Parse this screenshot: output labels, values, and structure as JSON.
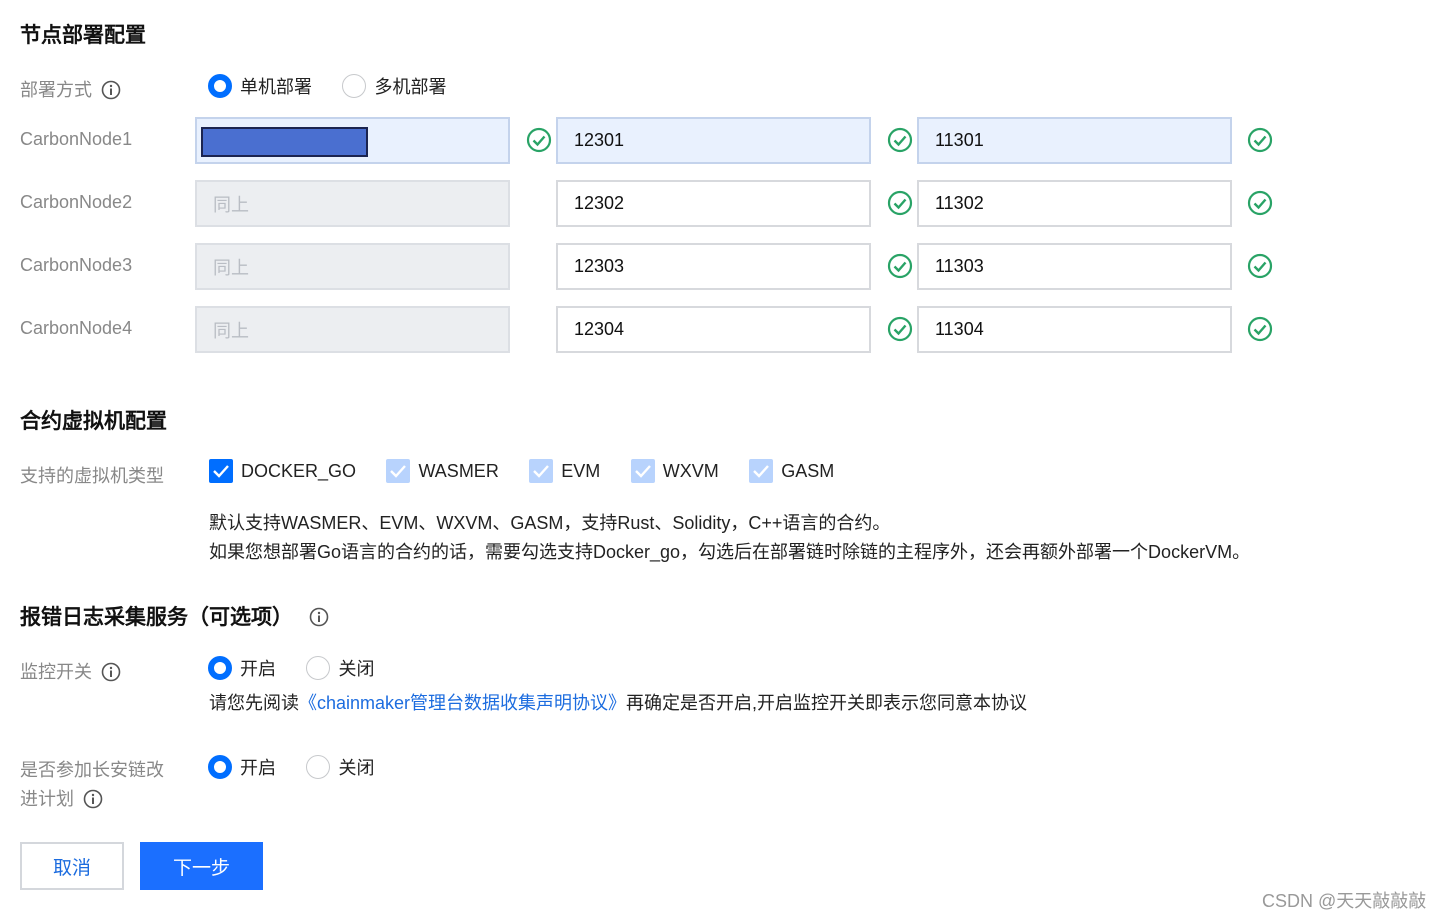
{
  "section_node": {
    "title": "节点部署配置",
    "deploy_mode_label": "部署方式",
    "options": [
      "单机部署",
      "多机部署"
    ],
    "selected": "单机部署"
  },
  "nodes": [
    {
      "name": "CarbonNode1",
      "ip": "",
      "port1": "12301",
      "port2": "11301"
    },
    {
      "name": "CarbonNode2",
      "ip": "同上",
      "port1": "12302",
      "port2": "11302"
    },
    {
      "name": "CarbonNode3",
      "ip": "同上",
      "port1": "12303",
      "port2": "11303"
    },
    {
      "name": "CarbonNode4",
      "ip": "同上",
      "port1": "12304",
      "port2": "11304"
    }
  ],
  "section_vm": {
    "title": "合约虚拟机配置",
    "vm_types_label": "支持的虚拟机类型",
    "vm_types": [
      {
        "label": "DOCKER_GO",
        "checked": true,
        "editable": true
      },
      {
        "label": "WASMER",
        "checked": true,
        "editable": false
      },
      {
        "label": "EVM",
        "checked": true,
        "editable": false
      },
      {
        "label": "WXVM",
        "checked": true,
        "editable": false
      },
      {
        "label": "GASM",
        "checked": true,
        "editable": false
      }
    ],
    "desc_line1": "默认支持WASMER、EVM、WXVM、GASM，支持Rust、Solidity，C++语言的合约。",
    "desc_line2": "如果您想部署Go语言的合约的话，需要勾选支持Docker_go，勾选后在部署链时除链的主程序外，还会再额外部署一个DockerVM。"
  },
  "section_log": {
    "title": "报错日志采集服务（可选项）",
    "monitor_label": "监控开关",
    "on_label": "开启",
    "off_label": "关闭",
    "monitor_selected": "开启",
    "notice_prefix": "请您先阅读",
    "notice_link": "《chainmaker管理台数据收集声明协议》",
    "notice_suffix": "再确定是否开启,开启监控开关即表示您同意本协议",
    "plan_label_line1": "是否参加长安链改",
    "plan_label_line2": "进计划",
    "plan_selected": "开启"
  },
  "footer": {
    "cancel": "取消",
    "next": "下一步",
    "watermark": "CSDN @天天敲敲敲"
  },
  "colors": {
    "primary": "#006eff",
    "success": "#29a366",
    "link": "#1c6cdf"
  }
}
